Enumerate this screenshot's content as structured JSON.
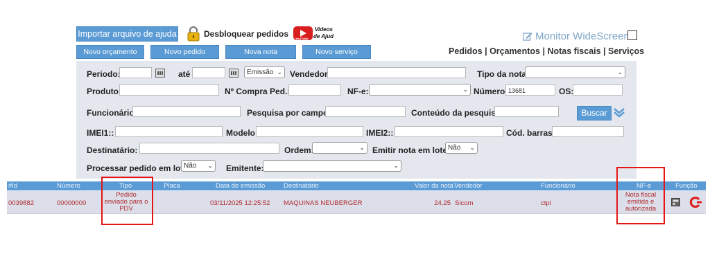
{
  "toolbar": {
    "import_help_label": "Importar arquivo de ajuda",
    "unlock_orders_label": "Desbloquear pedidos",
    "video_help_line1": "Videos",
    "video_help_line2": "de Ajuda",
    "video_help_brand": "YouTube",
    "new_quote_label": "Novo orçamento",
    "new_order_label": "Novo pedido",
    "new_invoice_label": "Nova nota",
    "new_service_label": "Novo serviço",
    "monitor_label": "Monitor WideScreen",
    "top_links": "Pedidos | Orçamentos | Notas fiscais | Serviços"
  },
  "filters": {
    "period_label": "Periodo:",
    "until_label": "até",
    "date_type_value": "Emissão",
    "seller_label": "Vendedor:",
    "invoice_type_label": "Tipo da nota:",
    "product_label": "Produto:",
    "purchase_order_label": "Nº Compra Ped.:",
    "nfe_label": "NF-e:",
    "number_label": "Número:",
    "number_value": "13681",
    "os_label": "OS:",
    "employee_label": "Funcionário:",
    "search_field_label": "Pesquisa por campo:",
    "search_content_label": "Conteúdo da pesquisa:",
    "search_button": "Buscar",
    "imei1_label": "IMEI1::",
    "model_label": "Modelo:",
    "imei2_label": "IMEI2::",
    "barcode_label": "Cód. barras:",
    "recipient_label": "Destinatário:",
    "order_label": "Ordem:",
    "batch_invoice_label": "Emitir nota em lote:",
    "batch_invoice_value": "Não",
    "batch_process_label": "Processar pedido em lote:",
    "batch_process_value": "Não",
    "issuer_label": "Emitente:"
  },
  "table": {
    "headers": [
      "#Id",
      "Número",
      "Tipo",
      "Placa",
      "Data de emissão",
      "Destinatário",
      "Valor da nota",
      "Vendedor",
      "Funcionário",
      "NF-e",
      "Função"
    ],
    "row": {
      "id": "0039882",
      "number": "00000000",
      "type_l1": "Pedido",
      "type_l2": "enviado para o",
      "type_l3": "PDV",
      "plate": "",
      "issue_date": "03/11/2025 12:25:52",
      "recipient": "MAQUINAS NEUBERGER",
      "value": "24,25",
      "seller": "Sicom",
      "employee": "ctpi",
      "nfe_l1": "Nota fiscal",
      "nfe_l2": "emitida e",
      "nfe_l3": "autorizada"
    }
  },
  "colors": {
    "accent": "#5b9bd5",
    "highlight_box": "#e51515",
    "row_text": "#b0282e"
  }
}
